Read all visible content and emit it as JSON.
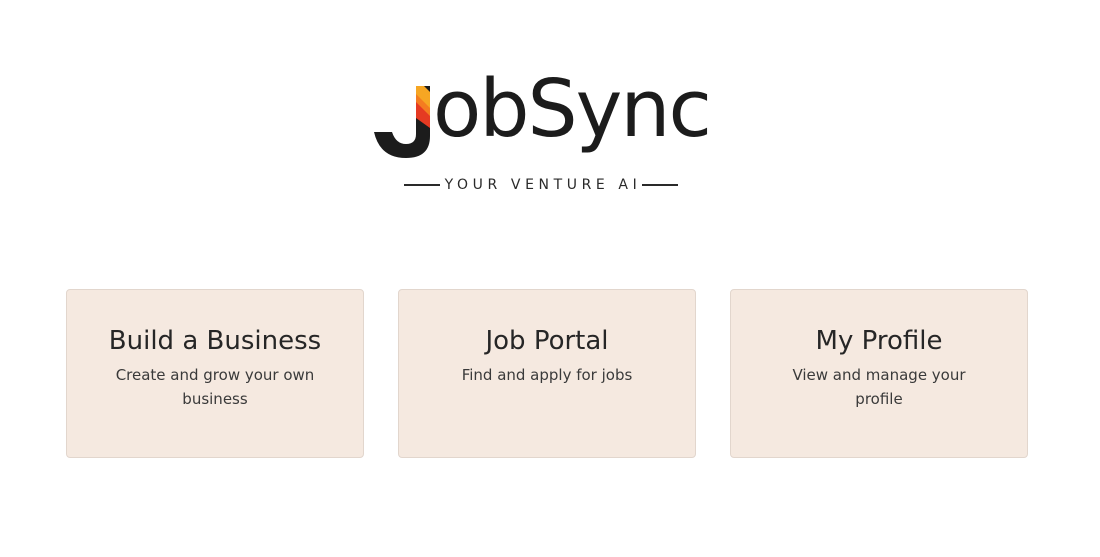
{
  "logo": {
    "wordmark": "obSync",
    "mark_letter": "J",
    "tagline": "YOUR VENTURE AI",
    "colors": {
      "mark_dark": "#1c1c1c",
      "flame_red": "#e53a22",
      "flame_orange": "#f47c20",
      "flame_yellow": "#f6a623"
    }
  },
  "cards": [
    {
      "title": "Build a Business",
      "description": "Create and grow your own business"
    },
    {
      "title": "Job Portal",
      "description": "Find and apply for jobs"
    },
    {
      "title": "My Profile",
      "description": "View and manage your profile"
    }
  ],
  "colors": {
    "card_background": "#f5e9e0",
    "card_border": "#e2d6cd",
    "page_background": "#ffffff"
  }
}
